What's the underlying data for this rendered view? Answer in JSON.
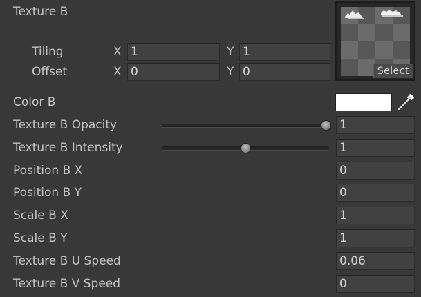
{
  "texture": {
    "title": "Texture B",
    "tiling_label": "Tiling",
    "offset_label": "Offset",
    "axis_x": "X",
    "axis_y": "Y",
    "tiling_x": "1",
    "tiling_y": "1",
    "offset_x": "0",
    "offset_y": "0",
    "select_label": "Select"
  },
  "color": {
    "label": "Color B",
    "value_hex": "#ffffff"
  },
  "properties": [
    {
      "label": "Texture B Opacity",
      "value": "1",
      "slider": true,
      "slider_fraction": 1.0
    },
    {
      "label": "Texture B Intensity",
      "value": "1",
      "slider": true,
      "slider_fraction": 0.5
    },
    {
      "label": "Position B X",
      "value": "0"
    },
    {
      "label": "Position B Y",
      "value": "0"
    },
    {
      "label": "Scale B X",
      "value": "1"
    },
    {
      "label": "Scale B Y",
      "value": "1"
    },
    {
      "label": "Texture B U Speed",
      "value": "0.06"
    },
    {
      "label": "Texture B V Speed",
      "value": "0"
    }
  ],
  "theme": {
    "background": "#383838",
    "field_background": "#414141",
    "text": "#c4c4c4"
  }
}
